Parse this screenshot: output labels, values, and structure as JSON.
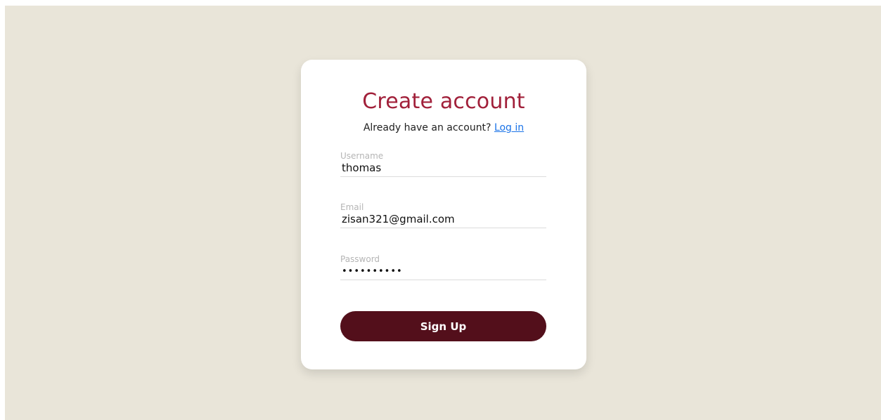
{
  "signup": {
    "title": "Create account",
    "subtitle_prefix": "Already have an account?",
    "login_link": "Log in",
    "fields": {
      "username": {
        "label": "Username",
        "value": "thomas"
      },
      "email": {
        "label": "Email",
        "value": "zisan321@gmail.com"
      },
      "password": {
        "label": "Password",
        "value": "••••••••••"
      }
    },
    "submit_label": "Sign Up"
  },
  "colors": {
    "page_background": "#e9e5d9",
    "card_background": "#ffffff",
    "title": "#a1203a",
    "link": "#1a73e8",
    "button": "#530f1b"
  }
}
